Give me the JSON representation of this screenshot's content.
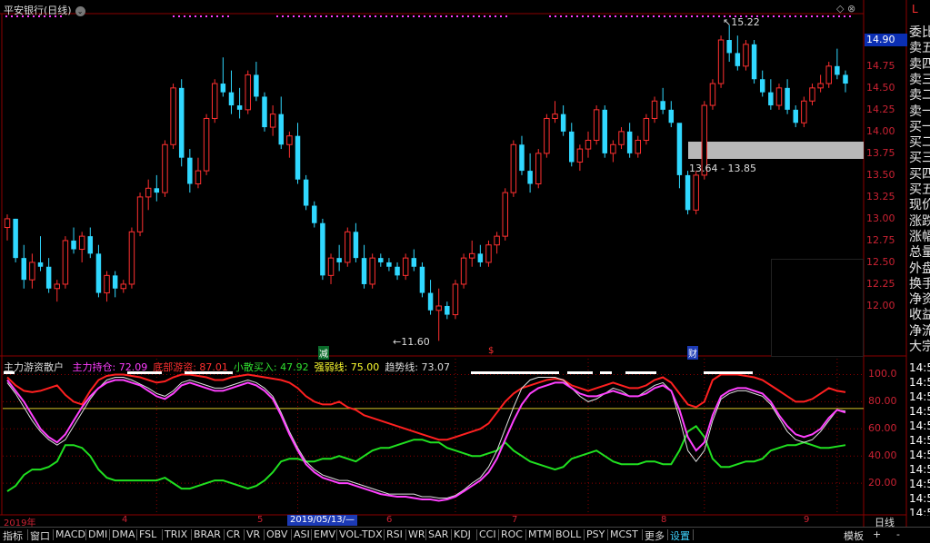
{
  "header": {
    "title": "平安银行(日线)",
    "right_symbols": "◇ ⊗",
    "corner_letter": "L"
  },
  "price_badge": "14.90",
  "price_axis": [
    "14.75",
    "14.50",
    "14.25",
    "14.00",
    "13.75",
    "13.50",
    "13.25",
    "13.00",
    "12.75",
    "12.50",
    "12.25",
    "12.00"
  ],
  "annotations": {
    "high": "15.22",
    "low": "11.60",
    "range": "13.64 - 13.85",
    "marker_jian": "减",
    "marker_dollar": "$",
    "marker_cai": "财"
  },
  "right_panel": {
    "labels": [
      "委比",
      "卖五",
      "卖四",
      "卖三",
      "卖二",
      "卖一",
      "买一",
      "买二",
      "买三",
      "买四",
      "买五",
      "现价",
      "涨跌",
      "涨幅",
      "总量",
      "外盘",
      "换手",
      "净资",
      "收益",
      "净流",
      "大宗"
    ],
    "axis_values": [
      "14:5",
      "14:5",
      "14:5",
      "14:5",
      "14:5",
      "14:5",
      "14:5",
      "14:5",
      "14:5",
      "14:5",
      "14:5",
      "15:0"
    ]
  },
  "indicator": {
    "name": "主力游资散户",
    "items": [
      {
        "label": "主力持仓:",
        "value": "72.09",
        "color": "#ff3cff"
      },
      {
        "label": "底部游资:",
        "value": "87.01",
        "color": "#ff3030"
      },
      {
        "label": "小散买入:",
        "value": "47.92",
        "color": "#30e030"
      },
      {
        "label": "强弱线:",
        "value": "75.00",
        "color": "#ffff30"
      },
      {
        "label": "趋势线:",
        "value": "73.07",
        "color": "#dddddd"
      }
    ],
    "axis": [
      "100.0",
      "80.00",
      "60.00",
      "40.00",
      "20.00"
    ]
  },
  "dates": {
    "year": "2019年",
    "months": [
      "4",
      "5",
      "6",
      "7",
      "8",
      "9"
    ],
    "cursor_date": "2019/05/13/—"
  },
  "tabs": [
    "指标",
    "窗口",
    "MACD",
    "DMI",
    "DMA",
    "FSL",
    "TRIX",
    "BRAR",
    "CR",
    "VR",
    "OBV",
    "ASI",
    "EMV",
    "VOL-TDX",
    "RSI",
    "WR",
    "SAR",
    "KDJ",
    "CCI",
    "ROC",
    "MTM",
    "BOLL",
    "PSY",
    "MCST",
    "更多",
    "设置"
  ],
  "bottom_right": [
    "模板",
    "+",
    "-",
    "日线"
  ],
  "colors": {
    "up": "#ff3030",
    "down": "#30d8ff",
    "ma": "#ffff30",
    "background": "#000000"
  },
  "chart_data": {
    "type": "candlestick",
    "ylim": [
      11.5,
      15.3
    ],
    "ohlc": [
      [
        12.9,
        13.05,
        12.75,
        13.0
      ],
      [
        13.0,
        13.0,
        12.5,
        12.55
      ],
      [
        12.55,
        12.7,
        12.2,
        12.3
      ],
      [
        12.3,
        12.6,
        12.2,
        12.5
      ],
      [
        12.5,
        12.8,
        12.4,
        12.45
      ],
      [
        12.45,
        12.55,
        12.15,
        12.2
      ],
      [
        12.2,
        12.3,
        12.05,
        12.25
      ],
      [
        12.25,
        12.8,
        12.2,
        12.75
      ],
      [
        12.75,
        12.9,
        12.6,
        12.65
      ],
      [
        12.65,
        12.85,
        12.5,
        12.8
      ],
      [
        12.8,
        12.9,
        12.55,
        12.6
      ],
      [
        12.6,
        12.7,
        12.1,
        12.15
      ],
      [
        12.15,
        12.4,
        12.05,
        12.35
      ],
      [
        12.35,
        12.4,
        12.1,
        12.2
      ],
      [
        12.2,
        12.3,
        12.15,
        12.25
      ],
      [
        12.25,
        12.9,
        12.2,
        12.85
      ],
      [
        12.85,
        13.3,
        12.8,
        13.25
      ],
      [
        13.25,
        13.45,
        13.1,
        13.35
      ],
      [
        13.35,
        13.5,
        13.2,
        13.3
      ],
      [
        13.3,
        13.9,
        13.25,
        13.85
      ],
      [
        13.85,
        14.55,
        13.8,
        14.5
      ],
      [
        14.5,
        14.6,
        13.6,
        13.7
      ],
      [
        13.7,
        13.8,
        13.3,
        13.4
      ],
      [
        13.4,
        13.7,
        13.35,
        13.55
      ],
      [
        13.55,
        14.2,
        13.5,
        14.15
      ],
      [
        14.15,
        14.6,
        14.1,
        14.55
      ],
      [
        14.55,
        14.85,
        14.4,
        14.45
      ],
      [
        14.45,
        14.7,
        14.2,
        14.3
      ],
      [
        14.3,
        14.5,
        14.15,
        14.25
      ],
      [
        14.25,
        14.7,
        14.2,
        14.65
      ],
      [
        14.65,
        14.8,
        14.35,
        14.4
      ],
      [
        14.4,
        14.45,
        14.0,
        14.05
      ],
      [
        14.05,
        14.3,
        13.95,
        14.2
      ],
      [
        14.2,
        14.4,
        13.8,
        13.85
      ],
      [
        13.85,
        14.0,
        13.7,
        13.95
      ],
      [
        13.95,
        14.1,
        13.4,
        13.45
      ],
      [
        13.45,
        13.5,
        13.1,
        13.15
      ],
      [
        13.15,
        13.2,
        12.9,
        12.95
      ],
      [
        12.95,
        13.0,
        12.3,
        12.35
      ],
      [
        12.35,
        12.6,
        12.25,
        12.55
      ],
      [
        12.55,
        12.7,
        12.4,
        12.5
      ],
      [
        12.5,
        12.9,
        12.45,
        12.85
      ],
      [
        12.85,
        12.95,
        12.5,
        12.55
      ],
      [
        12.55,
        12.7,
        12.2,
        12.25
      ],
      [
        12.25,
        12.6,
        12.2,
        12.55
      ],
      [
        12.55,
        12.6,
        12.45,
        12.5
      ],
      [
        12.5,
        12.55,
        12.4,
        12.45
      ],
      [
        12.45,
        12.5,
        12.3,
        12.35
      ],
      [
        12.35,
        12.6,
        12.3,
        12.55
      ],
      [
        12.55,
        12.65,
        12.4,
        12.45
      ],
      [
        12.45,
        12.5,
        12.1,
        12.15
      ],
      [
        12.15,
        12.3,
        11.9,
        11.95
      ],
      [
        11.95,
        12.2,
        11.6,
        12.0
      ],
      [
        12.0,
        12.05,
        11.85,
        11.9
      ],
      [
        11.9,
        12.3,
        11.85,
        12.25
      ],
      [
        12.25,
        12.6,
        12.2,
        12.55
      ],
      [
        12.55,
        12.75,
        12.45,
        12.6
      ],
      [
        12.6,
        12.7,
        12.45,
        12.5
      ],
      [
        12.5,
        12.75,
        12.45,
        12.7
      ],
      [
        12.7,
        12.85,
        12.6,
        12.8
      ],
      [
        12.8,
        13.35,
        12.75,
        13.3
      ],
      [
        13.3,
        13.9,
        13.25,
        13.85
      ],
      [
        13.85,
        13.95,
        13.5,
        13.55
      ],
      [
        13.55,
        13.75,
        13.3,
        13.4
      ],
      [
        13.4,
        13.8,
        13.35,
        13.75
      ],
      [
        13.75,
        14.2,
        13.7,
        14.15
      ],
      [
        14.15,
        14.35,
        14.1,
        14.2
      ],
      [
        14.2,
        14.3,
        13.95,
        14.0
      ],
      [
        14.0,
        14.1,
        13.6,
        13.65
      ],
      [
        13.65,
        13.85,
        13.55,
        13.8
      ],
      [
        13.8,
        14.0,
        13.7,
        13.9
      ],
      [
        13.9,
        14.3,
        13.85,
        14.25
      ],
      [
        14.25,
        14.3,
        13.7,
        13.75
      ],
      [
        13.75,
        13.9,
        13.65,
        13.85
      ],
      [
        13.85,
        14.05,
        13.8,
        14.0
      ],
      [
        14.0,
        14.1,
        13.7,
        13.75
      ],
      [
        13.75,
        13.95,
        13.7,
        13.9
      ],
      [
        13.9,
        14.2,
        13.85,
        14.15
      ],
      [
        14.15,
        14.4,
        14.1,
        14.35
      ],
      [
        14.35,
        14.5,
        14.2,
        14.25
      ],
      [
        14.25,
        14.35,
        14.05,
        14.1
      ],
      [
        14.1,
        13.85,
        13.35,
        13.5
      ],
      [
        13.5,
        13.55,
        13.05,
        13.1
      ],
      [
        13.1,
        13.55,
        13.05,
        13.5
      ],
      [
        13.5,
        14.35,
        13.45,
        14.3
      ],
      [
        14.3,
        14.6,
        14.25,
        14.55
      ],
      [
        14.55,
        15.1,
        14.5,
        15.05
      ],
      [
        15.05,
        15.22,
        14.8,
        14.9
      ],
      [
        14.9,
        15.1,
        14.7,
        14.75
      ],
      [
        14.75,
        15.05,
        14.7,
        15.0
      ],
      [
        15.0,
        15.05,
        14.55,
        14.6
      ],
      [
        14.6,
        14.7,
        14.4,
        14.45
      ],
      [
        14.45,
        14.6,
        14.25,
        14.3
      ],
      [
        14.3,
        14.55,
        14.25,
        14.5
      ],
      [
        14.5,
        14.6,
        14.2,
        14.25
      ],
      [
        14.25,
        14.3,
        14.05,
        14.1
      ],
      [
        14.1,
        14.4,
        14.05,
        14.35
      ],
      [
        14.35,
        14.55,
        14.3,
        14.5
      ],
      [
        14.5,
        14.65,
        14.45,
        14.55
      ],
      [
        14.55,
        14.8,
        14.5,
        14.75
      ],
      [
        14.75,
        14.95,
        14.6,
        14.65
      ],
      [
        14.65,
        14.7,
        14.45,
        14.55
      ]
    ],
    "ma": [
      12.85,
      12.8,
      12.7,
      12.62,
      12.55,
      12.45,
      12.38,
      12.42,
      12.5,
      12.58,
      12.62,
      12.55,
      12.48,
      12.42,
      12.38,
      12.45,
      12.62,
      12.82,
      13.02,
      13.25,
      13.5,
      13.62,
      13.68,
      13.75,
      13.85,
      13.98,
      14.1,
      14.2,
      14.28,
      14.35,
      14.38,
      14.35,
      14.28,
      14.2,
      14.1,
      13.98,
      13.82,
      13.62,
      13.4,
      13.2,
      13.02,
      12.88,
      12.78,
      12.68,
      12.6,
      12.55,
      12.52,
      12.48,
      12.45,
      12.45,
      12.4,
      12.32,
      12.22,
      12.15,
      12.12,
      12.18,
      12.28,
      12.38,
      12.48,
      12.58,
      12.75,
      12.95,
      13.12,
      13.28,
      13.45,
      13.62,
      13.78,
      13.88,
      13.92,
      13.92,
      13.9,
      13.9,
      13.9,
      13.88,
      13.88,
      13.86,
      13.88,
      13.92,
      13.98,
      14.02,
      14.0,
      13.92,
      13.82,
      13.78,
      13.82,
      13.95,
      14.12,
      14.3,
      14.48,
      14.62,
      14.72,
      14.75,
      14.72,
      14.68,
      14.62,
      14.55,
      14.5,
      14.48,
      14.48,
      14.5,
      14.52,
      14.53
    ],
    "indicator_series": {
      "底部游资": [
        98,
        92,
        88,
        87,
        88,
        90,
        92,
        85,
        80,
        78,
        88,
        96,
        99,
        100,
        100,
        99,
        98,
        96,
        94,
        95,
        98,
        100,
        100,
        99,
        98,
        96,
        96,
        98,
        99,
        100,
        99,
        98,
        97,
        96,
        94,
        90,
        84,
        80,
        78,
        78,
        80,
        76,
        74,
        70,
        68,
        66,
        64,
        62,
        60,
        58,
        56,
        54,
        52,
        52,
        54,
        56,
        58,
        60,
        64,
        72,
        80,
        86,
        90,
        92,
        94,
        96,
        97,
        96,
        92,
        90,
        88,
        90,
        92,
        94,
        92,
        90,
        90,
        92,
        96,
        98,
        94,
        86,
        78,
        76,
        80,
        96,
        100,
        100,
        100,
        99,
        98,
        96,
        92,
        88,
        84,
        80,
        80,
        82,
        86,
        90,
        88,
        87
      ],
      "主力持仓": [
        96,
        88,
        80,
        70,
        60,
        54,
        50,
        56,
        66,
        76,
        84,
        90,
        94,
        96,
        96,
        94,
        92,
        88,
        84,
        82,
        86,
        92,
        94,
        92,
        90,
        88,
        88,
        90,
        92,
        94,
        92,
        88,
        82,
        70,
        56,
        44,
        34,
        28,
        24,
        22,
        20,
        20,
        18,
        16,
        14,
        12,
        11,
        10,
        10,
        9,
        8,
        8,
        7,
        8,
        10,
        14,
        18,
        22,
        28,
        38,
        52,
        66,
        78,
        86,
        90,
        92,
        94,
        94,
        90,
        86,
        84,
        84,
        86,
        88,
        86,
        84,
        84,
        86,
        90,
        92,
        88,
        74,
        54,
        44,
        50,
        70,
        84,
        88,
        90,
        90,
        88,
        86,
        80,
        70,
        62,
        56,
        54,
        56,
        60,
        68,
        74,
        72
      ],
      "趋势线": [
        94,
        86,
        76,
        66,
        58,
        52,
        48,
        52,
        62,
        72,
        82,
        90,
        96,
        98,
        98,
        96,
        93,
        90,
        86,
        84,
        88,
        94,
        96,
        94,
        92,
        90,
        90,
        92,
        94,
        96,
        94,
        90,
        84,
        72,
        58,
        46,
        36,
        30,
        26,
        24,
        22,
        22,
        20,
        18,
        16,
        14,
        12,
        12,
        12,
        12,
        10,
        10,
        9,
        9,
        11,
        15,
        20,
        24,
        32,
        44,
        60,
        76,
        90,
        96,
        98,
        98,
        98,
        96,
        90,
        84,
        80,
        82,
        86,
        90,
        88,
        84,
        84,
        88,
        92,
        94,
        88,
        68,
        44,
        36,
        44,
        66,
        82,
        86,
        88,
        88,
        86,
        84,
        78,
        68,
        58,
        52,
        50,
        52,
        58,
        66,
        74,
        73
      ],
      "小散买入": [
        14,
        18,
        26,
        30,
        30,
        32,
        36,
        48,
        48,
        46,
        40,
        30,
        24,
        22,
        22,
        22,
        22,
        22,
        22,
        24,
        20,
        16,
        16,
        18,
        20,
        22,
        22,
        20,
        18,
        16,
        18,
        22,
        28,
        36,
        38,
        38,
        36,
        36,
        38,
        38,
        40,
        38,
        36,
        40,
        44,
        46,
        46,
        48,
        50,
        52,
        52,
        50,
        50,
        46,
        44,
        42,
        40,
        40,
        42,
        44,
        50,
        44,
        40,
        36,
        34,
        32,
        30,
        32,
        38,
        40,
        42,
        44,
        40,
        36,
        34,
        34,
        34,
        36,
        36,
        34,
        34,
        44,
        58,
        62,
        54,
        38,
        32,
        32,
        34,
        36,
        36,
        38,
        44,
        46,
        48,
        48,
        50,
        48,
        46,
        46,
        47,
        48
      ],
      "强弱线": 75
    }
  }
}
